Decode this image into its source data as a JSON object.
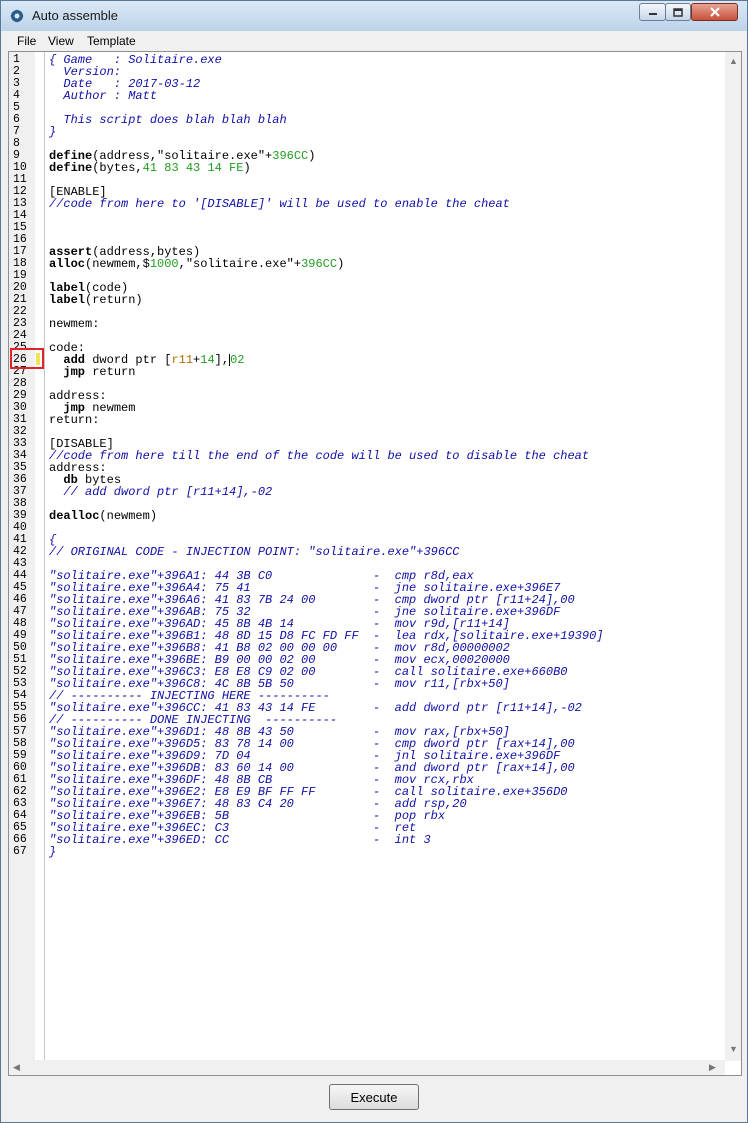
{
  "window": {
    "title": "Auto assemble"
  },
  "menu": {
    "file": "File",
    "view": "View",
    "template": "Template"
  },
  "line_numbers": [
    "1",
    "2",
    "3",
    "4",
    "5",
    "6",
    "7",
    "8",
    "9",
    "10",
    "11",
    "12",
    "13",
    "14",
    "15",
    "16",
    "17",
    "18",
    "19",
    "20",
    "21",
    "22",
    "23",
    "24",
    "25",
    "26",
    "27",
    "28",
    "29",
    "30",
    "31",
    "32",
    "33",
    "34",
    "35",
    "36",
    "37",
    "38",
    "39",
    "40",
    "41",
    "42",
    "43",
    "44",
    "45",
    "46",
    "47",
    "48",
    "49",
    "50",
    "51",
    "52",
    "53",
    "54",
    "55",
    "56",
    "57",
    "58",
    "59",
    "60",
    "61",
    "62",
    "63",
    "64",
    "65",
    "66",
    "67"
  ],
  "code": {
    "l1": "{ Game   : Solitaire.exe",
    "l2": "  Version:",
    "l3": "  Date   : 2017-03-12",
    "l4": "  Author : Matt",
    "l6": "  This script does blah blah blah",
    "l7": "}",
    "l9_kw": "define",
    "l9_rest": "(address,\"solitaire.exe\"+",
    "l9_num": "396CC",
    "l9_end": ")",
    "l10_kw": "define",
    "l10_rest": "(bytes,",
    "l10_num": "41 83 43 14 FE",
    "l10_end": ")",
    "l12": "[ENABLE]",
    "l13": "//code from here to '[DISABLE]' will be used to enable the cheat",
    "l17_kw": "assert",
    "l17_rest": "(address,bytes)",
    "l18_kw": "alloc",
    "l18_rest": "(newmem,$",
    "l18_num1": "1000",
    "l18_mid": ",\"solitaire.exe\"+",
    "l18_num2": "396CC",
    "l18_end": ")",
    "l20_kw": "label",
    "l20_rest": "(code)",
    "l21_kw": "label",
    "l21_rest": "(return)",
    "l23": "newmem:",
    "l25": "code:",
    "l26_kw": "add",
    "l26_a": " dword ptr [",
    "l26_reg": "r11",
    "l26_plus": "+",
    "l26_num": "14",
    "l26_b": "],",
    "l26_c": "02",
    "l27_kw": "jmp",
    "l27_rest": " return",
    "l29": "address:",
    "l30_kw": "jmp",
    "l30_rest": " newmem",
    "l31": "return:",
    "l33": "[DISABLE]",
    "l34": "//code from here till the end of the code will be used to disable the cheat",
    "l35": "address:",
    "l36_kw": "db",
    "l36_rest": " bytes",
    "l37": "  // add dword ptr [r11+14],-02",
    "l39_kw": "dealloc",
    "l39_rest": "(newmem)",
    "l41": "{",
    "l42": "// ORIGINAL CODE - INJECTION POINT: \"solitaire.exe\"+396CC",
    "l44": "\"solitaire.exe\"+396A1: 44 3B C0              -  cmp r8d,eax",
    "l45": "\"solitaire.exe\"+396A4: 75 41                 -  jne solitaire.exe+396E7",
    "l46": "\"solitaire.exe\"+396A6: 41 83 7B 24 00        -  cmp dword ptr [r11+24],00",
    "l47": "\"solitaire.exe\"+396AB: 75 32                 -  jne solitaire.exe+396DF",
    "l48": "\"solitaire.exe\"+396AD: 45 8B 4B 14           -  mov r9d,[r11+14]",
    "l49": "\"solitaire.exe\"+396B1: 48 8D 15 D8 FC FD FF  -  lea rdx,[solitaire.exe+19390]",
    "l50": "\"solitaire.exe\"+396B8: 41 B8 02 00 00 00     -  mov r8d,00000002",
    "l51": "\"solitaire.exe\"+396BE: B9 00 00 02 00        -  mov ecx,00020000",
    "l52": "\"solitaire.exe\"+396C3: E8 E8 C9 02 00        -  call solitaire.exe+660B0",
    "l53": "\"solitaire.exe\"+396C8: 4C 8B 5B 50           -  mov r11,[rbx+50]",
    "l54": "// ---------- INJECTING HERE ----------",
    "l55": "\"solitaire.exe\"+396CC: 41 83 43 14 FE        -  add dword ptr [r11+14],-02",
    "l56": "// ---------- DONE INJECTING  ----------",
    "l57": "\"solitaire.exe\"+396D1: 48 8B 43 50           -  mov rax,[rbx+50]",
    "l58": "\"solitaire.exe\"+396D5: 83 78 14 00           -  cmp dword ptr [rax+14],00",
    "l59": "\"solitaire.exe\"+396D9: 7D 04                 -  jnl solitaire.exe+396DF",
    "l60": "\"solitaire.exe\"+396DB: 83 60 14 00           -  and dword ptr [rax+14],00",
    "l61": "\"solitaire.exe\"+396DF: 48 8B CB              -  mov rcx,rbx",
    "l62": "\"solitaire.exe\"+396E2: E8 E9 BF FF FF        -  call solitaire.exe+356D0",
    "l63": "\"solitaire.exe\"+396E7: 48 83 C4 20           -  add rsp,20",
    "l64": "\"solitaire.exe\"+396EB: 5B                    -  pop rbx",
    "l65": "\"solitaire.exe\"+396EC: C3                    -  ret",
    "l66": "\"solitaire.exe\"+396ED: CC                    -  int 3",
    "l67": "}"
  },
  "execute_label": "Execute"
}
